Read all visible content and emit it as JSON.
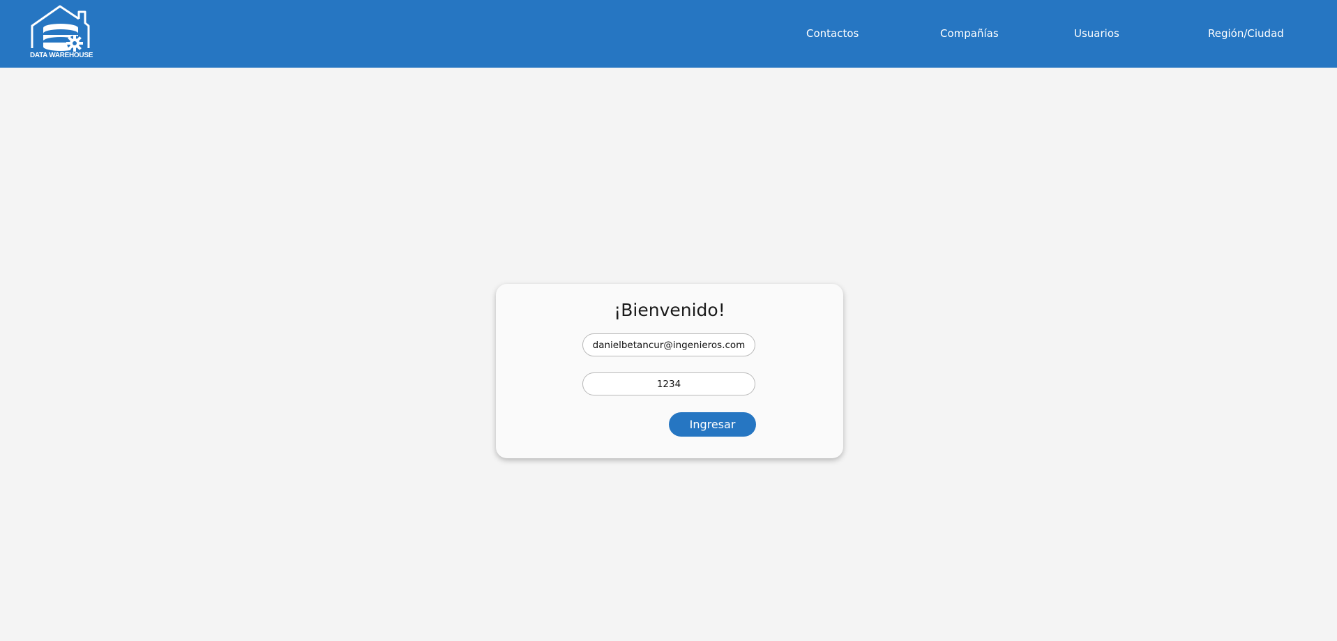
{
  "header": {
    "logo_text": "DATA WAREHOUSE",
    "nav": {
      "contactos": "Contactos",
      "companias": "Compañías",
      "usuarios": "Usuarios",
      "region": "Región/Ciudad"
    }
  },
  "login": {
    "title": "¡Bienvenido!",
    "email_value": "danielbetancur@ingenieros.com",
    "password_value": "1234",
    "submit_label": "Ingresar"
  },
  "colors": {
    "brand": "#2676c2",
    "background": "#f4f4f4",
    "card": "#fafafa"
  },
  "icons": {
    "logo": "house-database-gear-icon"
  }
}
